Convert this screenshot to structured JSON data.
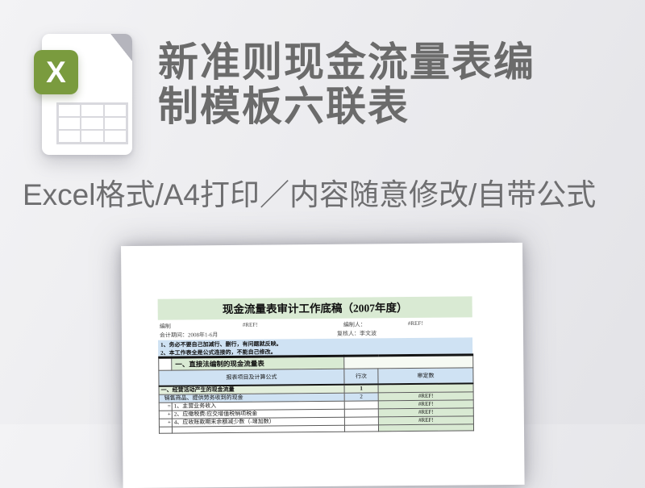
{
  "header": {
    "title_line1": "新准则现金流量表编",
    "title_line2": "制模板六联表",
    "subtitle": "Excel格式/A4打印／内容随意修改/自带公式"
  },
  "icon": {
    "badge_letter": "X",
    "badge_color": "#7a9b3e",
    "fold_color": "#b5b5bd"
  },
  "colors": {
    "headline_gray": "#6b6b6b",
    "sheet_green": "#d9ead3",
    "sheet_blue": "#cfe2f3"
  },
  "sheet": {
    "title": "现金流量表审计工作底稿（2007年度）",
    "meta": {
      "prepared_label": "编制",
      "prepared_value": "#REF!",
      "preparer_label": "编制人：",
      "preparer_value": "#REF!",
      "period_label": "会计期间：2008年1-6月",
      "reviewer_label": "复核人：李文波"
    },
    "notes": [
      "1、务必不要自己加减行、删行，有问题就反映。",
      "2、本工作表全是公式连接的，不能自己修改。"
    ],
    "section_title": "一、直接法编制的现金流量表",
    "columns": {
      "item": "报表项目及计算公式",
      "line_no": "行次",
      "audited": "审定数"
    },
    "rows": [
      {
        "op": "",
        "item": "一、经营活动产生的现金流量",
        "line_no": "1",
        "value": ""
      },
      {
        "op": "",
        "item": "销售商品、提供劳务收到的现金",
        "line_no": "2",
        "value": "#REF!"
      },
      {
        "op": "=",
        "item": "1、主营业务收入",
        "line_no": "",
        "value": "#REF!"
      },
      {
        "op": "+",
        "item": "2、应缴税费/应交增值税销项税金",
        "line_no": "",
        "value": "#REF!"
      },
      {
        "op": "+",
        "item": "4、应收账款期末余额减少数（-增加数）",
        "line_no": "",
        "value": "#REF!"
      },
      {
        "op": "",
        "item": "",
        "line_no": "",
        "value": ""
      }
    ]
  }
}
